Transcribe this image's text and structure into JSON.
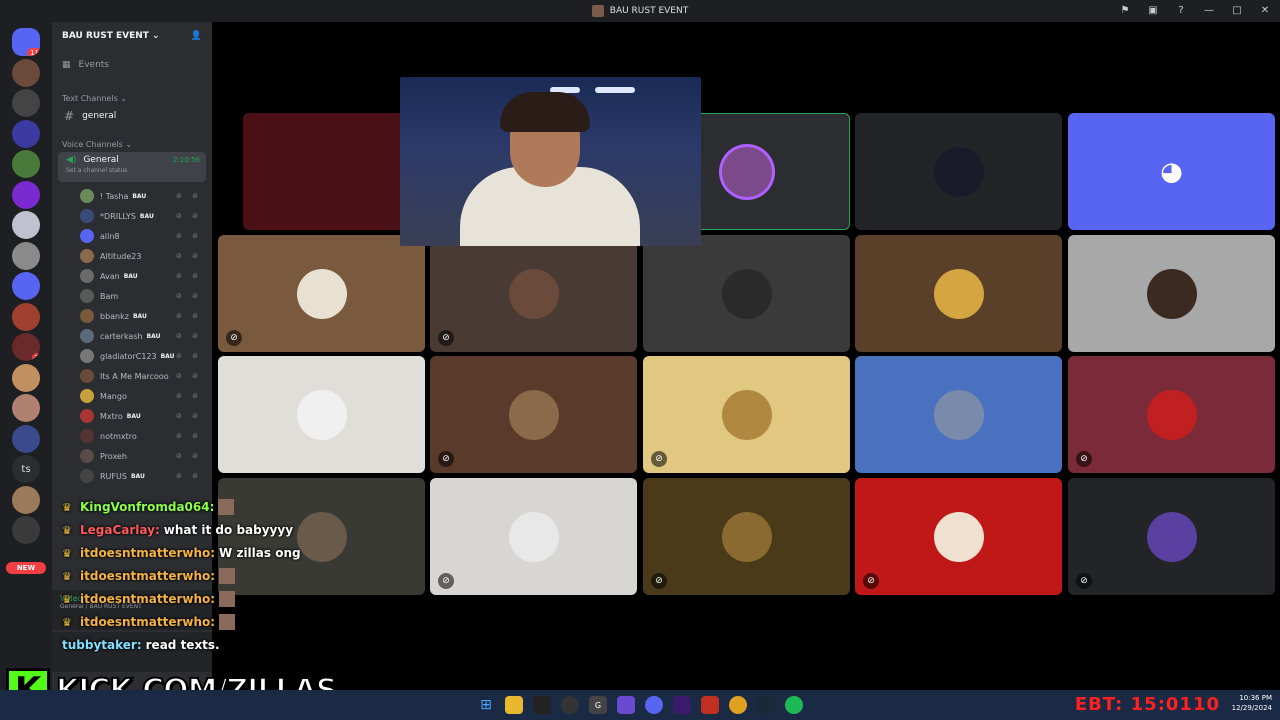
{
  "window": {
    "title": "BAU RUST EVENT"
  },
  "server": {
    "name": "BAU RUST EVENT",
    "events_label": "Events"
  },
  "categories": {
    "text": "Text Channels",
    "voice": "Voice Channels"
  },
  "text_channel": "general",
  "voice_channel": {
    "name": "General",
    "timer": "2:10:56",
    "status": "Set a channel status"
  },
  "members": [
    {
      "name": "! Tasha",
      "tag": "BAU",
      "color": "#6a8a5a"
    },
    {
      "name": "*DRILLYS",
      "tag": "BAU",
      "color": "#3a4a7a"
    },
    {
      "name": "alln8",
      "tag": "",
      "color": "#5865f2"
    },
    {
      "name": "Altitude23",
      "tag": "",
      "color": "#8a6a4a"
    },
    {
      "name": "Avan",
      "tag": "BAU",
      "color": "#6a6a6a"
    },
    {
      "name": "Bam",
      "tag": "",
      "color": "#5a5a5a"
    },
    {
      "name": "bbankz",
      "tag": "BAU",
      "color": "#7a5a3a"
    },
    {
      "name": "carterkash",
      "tag": "BAU",
      "color": "#5a6a7a"
    },
    {
      "name": "gladiatorC123",
      "tag": "BAU",
      "color": "#777"
    },
    {
      "name": "Its A Me Marcooo",
      "tag": "",
      "color": "#6a4a3a"
    },
    {
      "name": "Mango",
      "tag": "",
      "color": "#c8a040"
    },
    {
      "name": "Mxtro",
      "tag": "BAU",
      "color": "#aa3333"
    },
    {
      "name": "notmxtro",
      "tag": "",
      "color": "#553333"
    },
    {
      "name": "Proxeh",
      "tag": "",
      "color": "#5a4a4a"
    },
    {
      "name": "RUFUS",
      "tag": "BAU",
      "color": "#444"
    }
  ],
  "tiles": [
    {
      "bg": "#4a1015",
      "avatar": "#3a0a10",
      "muted": false
    },
    {
      "bg": "#2b2d31",
      "avatar": "#7a4a8a",
      "muted": false
    },
    {
      "bg": "#232428",
      "avatar": "#1a1a2a",
      "muted": false
    },
    {
      "bg": "#5865f2",
      "avatar": "#5865f2",
      "muted": false
    },
    {
      "bg": "#7a5a3e",
      "avatar": "#e8e0d0",
      "muted": true
    },
    {
      "bg": "#4a3a34",
      "avatar": "#6a4a3a",
      "muted": true
    },
    {
      "bg": "#3a3a3a",
      "avatar": "#2a2a2a",
      "muted": false
    },
    {
      "bg": "#5a4028",
      "avatar": "#d4a540",
      "muted": false
    },
    {
      "bg": "#a8a8a8",
      "avatar": "#3a2a20",
      "muted": false
    },
    {
      "bg": "#e0ded8",
      "avatar": "#f0f0f0",
      "muted": false
    },
    {
      "bg": "#5a3a2a",
      "avatar": "#8a6a4a",
      "muted": true
    },
    {
      "bg": "#e0c880",
      "avatar": "#b08840",
      "muted": true
    },
    {
      "bg": "#4a70c0",
      "avatar": "#7a8aaa",
      "muted": false
    },
    {
      "bg": "#7a2a38",
      "avatar": "#c02020",
      "muted": true
    },
    {
      "bg": "#3a3a34",
      "avatar": "#6a5a4a",
      "muted": false
    },
    {
      "bg": "#d8d6d2",
      "avatar": "#e8e8e8",
      "muted": true
    },
    {
      "bg": "#4a3a1a",
      "avatar": "#8a6a30",
      "muted": true
    },
    {
      "bg": "#c01818",
      "avatar": "#f0e0d0",
      "muted": true
    },
    {
      "bg": "#232428",
      "avatar": "#5a40a0",
      "muted": true
    }
  ],
  "chat": [
    {
      "user": "KingVonfromda064:",
      "text": "",
      "user_color": "#8bff4a"
    },
    {
      "user": "LegaCarlay:",
      "text": "what it do babyyyy",
      "user_color": "#ff5a5a"
    },
    {
      "user": "itdoesntmatterwho:",
      "text": "W zillas ong",
      "user_color": "#f4b342"
    },
    {
      "user": "itdoesntmatterwho:",
      "text": "",
      "user_color": "#f4b342"
    },
    {
      "user": "itdoesntmatterwho:",
      "text": "",
      "user_color": "#f4b342"
    },
    {
      "user": "itdoesntmatterwho:",
      "text": "",
      "user_color": "#f4b342"
    },
    {
      "user": "tubbytaker:",
      "text": "read texts.",
      "user_color": "#7fe0ff"
    }
  ],
  "voice_panel": {
    "label": "Video",
    "path": "General / BAU RUST EVENT"
  },
  "overlay": {
    "kick_letter": "K",
    "kick_url": "KICK.COM/ZILLAS",
    "ebt": "EBT: 15:0110"
  },
  "guilds": [
    {
      "label": "",
      "color": "#5865f2",
      "badge": "11"
    },
    {
      "label": "",
      "color": "#6a4a3a",
      "badge": ""
    },
    {
      "label": "",
      "color": "#444",
      "badge": ""
    },
    {
      "label": "",
      "color": "#3a3aa0",
      "badge": ""
    },
    {
      "label": "",
      "color": "#4a7a3a",
      "badge": ""
    },
    {
      "label": "",
      "color": "#7a2ad0",
      "badge": ""
    },
    {
      "label": "",
      "color": "#c0c0d0",
      "badge": ""
    },
    {
      "label": "",
      "color": "#8a8a8a",
      "badge": ""
    },
    {
      "label": "",
      "color": "#5865f2",
      "badge": ""
    },
    {
      "label": "",
      "color": "#a04030",
      "badge": ""
    },
    {
      "label": "",
      "color": "#6a2a2a",
      "badge": "1"
    },
    {
      "label": "",
      "color": "#c09060",
      "badge": ""
    },
    {
      "label": "",
      "color": "#b08070",
      "badge": ""
    },
    {
      "label": "",
      "color": "#3a4a8a",
      "badge": ""
    },
    {
      "label": "ts",
      "color": "#2b2d31",
      "badge": ""
    },
    {
      "label": "",
      "color": "#9a7a5a",
      "badge": ""
    },
    {
      "label": "",
      "color": "#3a3a3a",
      "badge": ""
    }
  ],
  "new_badge": "NEW",
  "tray": {
    "time": "10:36 PM",
    "date": "12/29/2024"
  }
}
